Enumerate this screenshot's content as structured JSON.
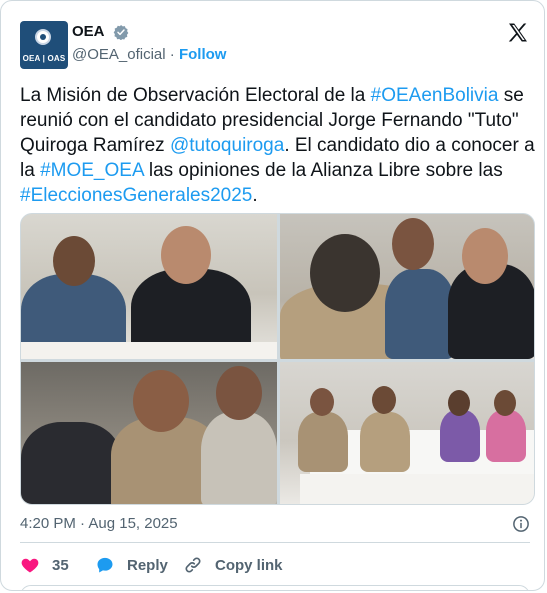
{
  "account": {
    "display_name": "OEA",
    "handle": "@OEA_oficial",
    "separator": "·",
    "follow_label": "Follow",
    "avatar_text": "OEA | OAS",
    "verified_color": "#829aab"
  },
  "tweet": {
    "segments": [
      {
        "text": "La Misión de Observación Electoral de la ",
        "link": false
      },
      {
        "text": "#OEAenBolivia",
        "link": true
      },
      {
        "text": " se reunió con el candidato presidencial Jorge Fernando \"Tuto\" Quiroga Ramírez ",
        "link": false
      },
      {
        "text": "@tutoquiroga",
        "link": true
      },
      {
        "text": ". El candidato dio a conocer a la ",
        "link": false
      },
      {
        "text": "#MOE_OEA",
        "link": true
      },
      {
        "text": " las opiniones de la Alianza Libre sobre las ",
        "link": false
      },
      {
        "text": "#EleccionesGenerales2025",
        "link": true
      },
      {
        "text": ".",
        "link": false
      }
    ],
    "link_color": "#1d9bf0"
  },
  "media": {
    "photo_count": 4
  },
  "meta": {
    "timestamp": "4:20 PM · Aug 15, 2025"
  },
  "actions": {
    "like_count": "35",
    "reply_label": "Reply",
    "copy_link_label": "Copy link",
    "like_color": "#f91880",
    "reply_color": "#1d9bf0"
  },
  "icons": {
    "brand": "x-logo-icon",
    "verified": "verified-badge-icon",
    "info": "info-icon",
    "like": "heart-icon",
    "reply": "speech-bubble-icon",
    "copy": "link-icon"
  }
}
